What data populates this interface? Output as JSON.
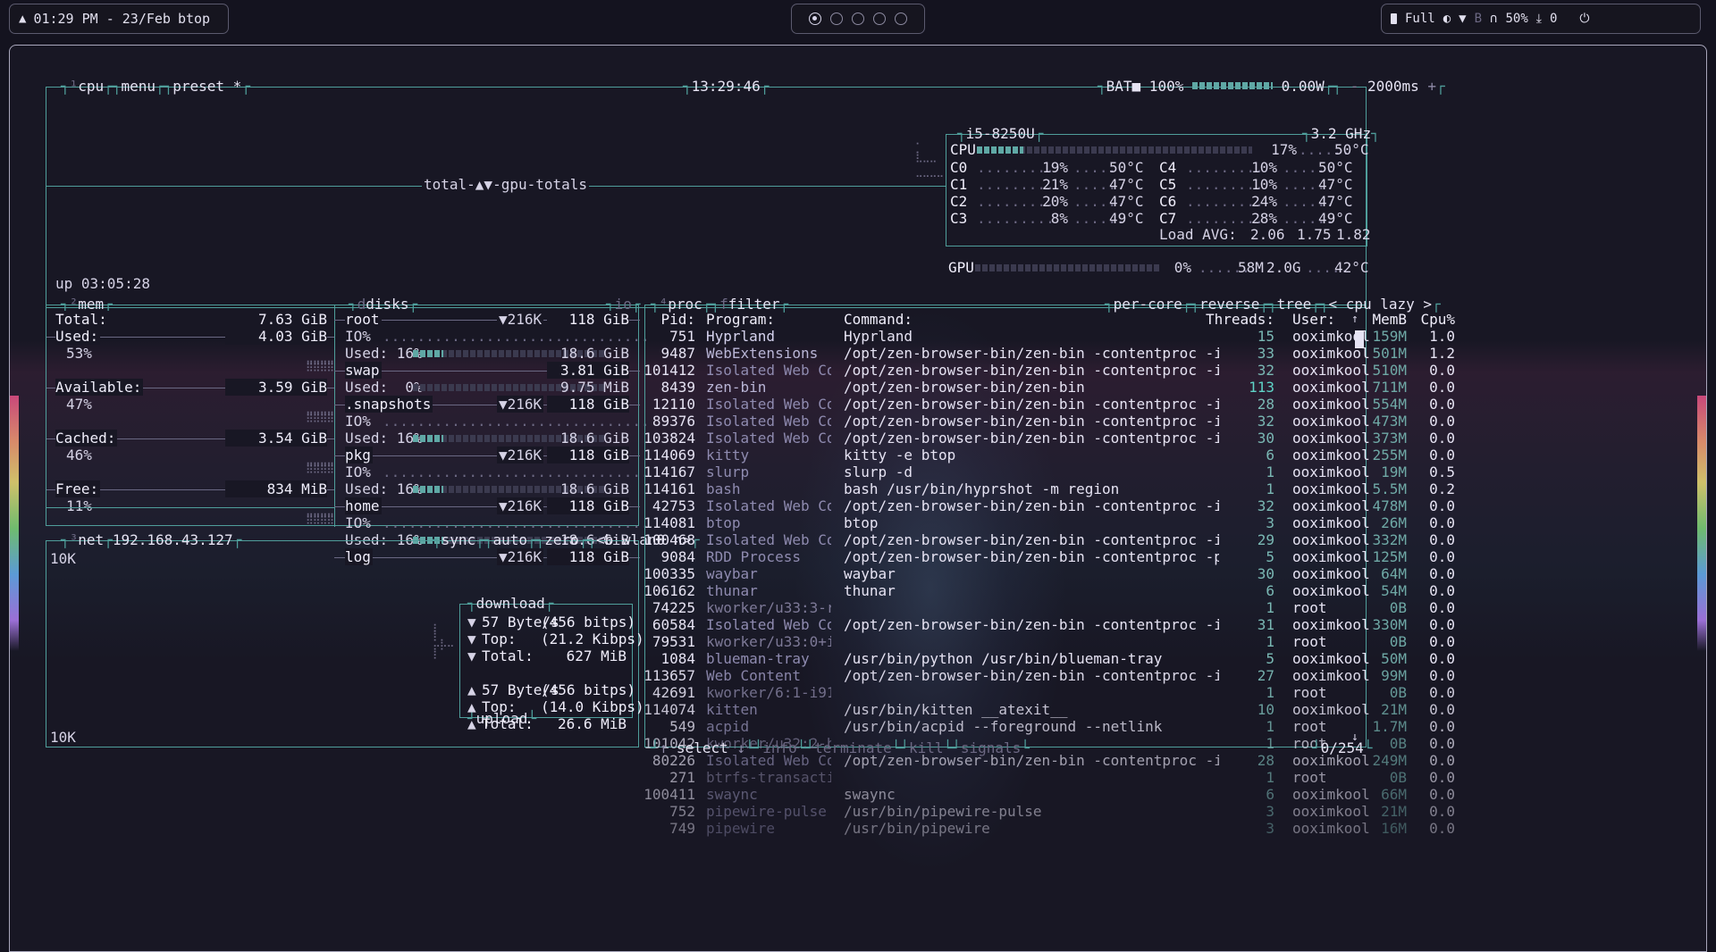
{
  "topbar": {
    "time": "01:29 PM - 23/Feb",
    "app": "btop",
    "workspaces": [
      true,
      false,
      false,
      false,
      false
    ],
    "power_profile": "Full",
    "volume": "50%",
    "downloads": "0"
  },
  "cpu_box": {
    "tabs": [
      "cpu",
      "menu",
      "preset *"
    ],
    "clock": "13:29:46",
    "battery": "BAT■ 100%",
    "battery_watts": "0.00W",
    "interval": "2000ms",
    "graph_label": "total-▲▼-gpu-totals",
    "uptime": "up 03:05:28",
    "cpu_name": "i5-8250U",
    "freq": "3.2 GHz",
    "total": {
      "label": "CPU",
      "pct": "17%",
      "temp": "50°C",
      "value": 0.17
    },
    "cores": [
      {
        "label": "C0",
        "pct": "19%",
        "temp": "50°C"
      },
      {
        "label": "C1",
        "pct": "21%",
        "temp": "47°C"
      },
      {
        "label": "C2",
        "pct": "20%",
        "temp": "47°C"
      },
      {
        "label": "C3",
        "pct": "8%",
        "temp": "49°C"
      },
      {
        "label": "C4",
        "pct": "10%",
        "temp": "50°C"
      },
      {
        "label": "C5",
        "pct": "10%",
        "temp": "47°C"
      },
      {
        "label": "C6",
        "pct": "24%",
        "temp": "47°C"
      },
      {
        "label": "C7",
        "pct": "28%",
        "temp": "49°C"
      }
    ],
    "load_avg_label": "Load AVG:",
    "load_avg": [
      "2.06",
      "1.75",
      "1.82"
    ],
    "gpu": {
      "label": "GPU",
      "pct": "0%",
      "mem": "58M",
      "total": "2.0G",
      "temp": "42°C"
    }
  },
  "mem_box": {
    "title": "mem",
    "rows": [
      {
        "label": "Total:",
        "value": "7.63 GiB",
        "pct": ""
      },
      {
        "label": "Used:",
        "value": "4.03 GiB",
        "pct": "53%"
      },
      {
        "label": "Available:",
        "value": "3.59 GiB",
        "pct": "47%"
      },
      {
        "label": "Cached:",
        "value": "3.54 GiB",
        "pct": "46%"
      },
      {
        "label": "Free:",
        "value": "834 MiB",
        "pct": "11%"
      }
    ]
  },
  "disks_box": {
    "title": "disks",
    "io_label": "io",
    "disks": [
      {
        "name": "root",
        "speed": "▼216K",
        "size": "118 GiB",
        "io": "IO%",
        "used_label": "Used: 16%",
        "used": "18.6 GiB",
        "value": 0.16
      },
      {
        "name": "swap",
        "speed": "",
        "size": "3.81 GiB",
        "io": "",
        "used_label": "Used:  0%",
        "used": "9.75 MiB",
        "value": 0.0
      },
      {
        "name": ".snapshots",
        "speed": "▼216K",
        "size": "118 GiB",
        "io": "IO%",
        "used_label": "Used: 16%",
        "used": "18.6 GiB",
        "value": 0.16
      },
      {
        "name": "pkg",
        "speed": "▼216K",
        "size": "118 GiB",
        "io": "IO%",
        "used_label": "Used: 16%",
        "used": "18.6 GiB",
        "value": 0.16
      },
      {
        "name": "home",
        "speed": "▼216K",
        "size": "118 GiB",
        "io": "IO%",
        "used_label": "Used: 16%",
        "used": "18.6 GiB",
        "value": 0.16
      },
      {
        "name": "log",
        "speed": "▼216K",
        "size": "118 GiB",
        "io": "",
        "used_label": "",
        "used": "",
        "value": 0
      }
    ]
  },
  "net_box": {
    "title": "net",
    "ip": "192.168.43.127",
    "options": [
      "sync",
      "auto",
      "zero"
    ],
    "iface": "<b wlan0 n>",
    "scale_top": "10K",
    "scale_bottom": "10K",
    "download_label": "download",
    "upload_label": "upload",
    "download": [
      {
        "arrow": "▼",
        "label": "57 Byte/s",
        "value": "(456 bitps)"
      },
      {
        "arrow": "▼",
        "label": "Top:",
        "value": "(21.2 Kibps)"
      },
      {
        "arrow": "▼",
        "label": "Total:",
        "value": "627 MiB"
      }
    ],
    "upload": [
      {
        "arrow": "▲",
        "label": "57 Byte/s",
        "value": "(456 bitps)"
      },
      {
        "arrow": "▲",
        "label": "Top:",
        "value": "(14.0 Kibps)"
      },
      {
        "arrow": "▲",
        "label": "Total:",
        "value": "26.6 MiB"
      }
    ]
  },
  "proc_box": {
    "title": "proc",
    "filter": "filter",
    "options": [
      "per-core",
      "reverse",
      "tree"
    ],
    "sort": "< cpu lazy >",
    "headers": [
      "Pid:",
      "Program:",
      "Command:",
      "Threads:",
      "User:",
      "MemB",
      "Cpu%"
    ],
    "count": "0/254",
    "footer": [
      "select",
      "info",
      "terminate",
      "kill",
      "signals"
    ],
    "rows": [
      [
        "751",
        "Hyprland",
        "Hyprland",
        "15",
        "ooximkool",
        "159M",
        "1.0"
      ],
      [
        "9487",
        "WebExtensions",
        "/opt/zen-browser-bin/zen-bin -contentproc -isForB",
        "33",
        "ooximkool",
        "501M",
        "1.2"
      ],
      [
        "101412",
        "Isolated Web Co",
        "/opt/zen-browser-bin/zen-bin -contentproc -isForB",
        "32",
        "ooximkool",
        "510M",
        "0.0"
      ],
      [
        "8439",
        "zen-bin",
        "/opt/zen-browser-bin/zen-bin",
        "113",
        "ooximkool",
        "711M",
        "0.0"
      ],
      [
        "12110",
        "Isolated Web Co",
        "/opt/zen-browser-bin/zen-bin -contentproc -isForB",
        "28",
        "ooximkool",
        "554M",
        "0.0"
      ],
      [
        "89376",
        "Isolated Web Co",
        "/opt/zen-browser-bin/zen-bin -contentproc -isForB",
        "32",
        "ooximkool",
        "473M",
        "0.0"
      ],
      [
        "103824",
        "Isolated Web Co",
        "/opt/zen-browser-bin/zen-bin -contentproc -isForB",
        "30",
        "ooximkool",
        "373M",
        "0.0"
      ],
      [
        "114069",
        "kitty",
        "kitty -e btop",
        "6",
        "ooximkool",
        "255M",
        "0.0"
      ],
      [
        "114167",
        "slurp",
        "slurp -d",
        "1",
        "ooximkool",
        "19M",
        "0.5"
      ],
      [
        "114161",
        "bash",
        "bash /usr/bin/hyprshot -m region",
        "1",
        "ooximkool",
        "5.5M",
        "0.2"
      ],
      [
        "42753",
        "Isolated Web Co",
        "/opt/zen-browser-bin/zen-bin -contentproc -isForB",
        "32",
        "ooximkool",
        "478M",
        "0.0"
      ],
      [
        "114081",
        "btop",
        "btop",
        "3",
        "ooximkool",
        "26M",
        "0.0"
      ],
      [
        "100468",
        "Isolated Web Co",
        "/opt/zen-browser-bin/zen-bin -contentproc -isForB",
        "29",
        "ooximkool",
        "332M",
        "0.0"
      ],
      [
        "9084",
        "RDD Process",
        "/opt/zen-browser-bin/zen-bin -contentproc -parent",
        "5",
        "ooximkool",
        "125M",
        "0.0"
      ],
      [
        "100335",
        "waybar",
        "waybar",
        "30",
        "ooximkool",
        "64M",
        "0.0"
      ],
      [
        "106162",
        "thunar",
        "thunar",
        "6",
        "ooximkool",
        "54M",
        "0.0"
      ],
      [
        "74225",
        "kworker/u33:3-rb",
        "",
        "1",
        "root",
        "0B",
        "0.0"
      ],
      [
        "60584",
        "Isolated Web Co",
        "/opt/zen-browser-bin/zen-bin -contentproc -isForB",
        "31",
        "ooximkool",
        "330M",
        "0.0"
      ],
      [
        "79531",
        "kworker/u33:0+i9",
        "",
        "1",
        "root",
        "0B",
        "0.0"
      ],
      [
        "1084",
        "blueman-tray",
        "/usr/bin/python /usr/bin/blueman-tray",
        "5",
        "ooximkool",
        "50M",
        "0.0"
      ],
      [
        "113657",
        "Web Content",
        "/opt/zen-browser-bin/zen-bin -contentproc -isForB",
        "27",
        "ooximkool",
        "99M",
        "0.0"
      ],
      [
        "42691",
        "kworker/6:1-i915",
        "",
        "1",
        "root",
        "0B",
        "0.0"
      ],
      [
        "114074",
        "kitten",
        "/usr/bin/kitten __atexit__",
        "10",
        "ooximkool",
        "21M",
        "0.0"
      ],
      [
        "549",
        "acpid",
        "/usr/bin/acpid --foreground --netlink",
        "1",
        "root",
        "1.7M",
        "0.0"
      ],
      [
        "101042",
        "kworker/u32:2-bt",
        "",
        "1",
        "root",
        "0B",
        "0.0"
      ],
      [
        "80226",
        "Isolated Web Co",
        "/opt/zen-browser-bin/zen-bin -contentproc -isForB",
        "28",
        "ooximkool",
        "249M",
        "0.0"
      ],
      [
        "271",
        "btrfs-transactio",
        "",
        "1",
        "root",
        "0B",
        "0.0"
      ],
      [
        "100411",
        "swaync",
        "swaync",
        "6",
        "ooximkool",
        "66M",
        "0.0"
      ],
      [
        "752",
        "pipewire-pulse",
        "/usr/bin/pipewire-pulse",
        "3",
        "ooximkool",
        "21M",
        "0.0"
      ],
      [
        "749",
        "pipewire",
        "/usr/bin/pipewire",
        "3",
        "ooximkool",
        "16M",
        "0.0"
      ]
    ]
  },
  "colors": {
    "border": "#4f9e9b",
    "accent": "#5fa8a5",
    "text": "#d6d3e6",
    "bg": "#181724"
  }
}
